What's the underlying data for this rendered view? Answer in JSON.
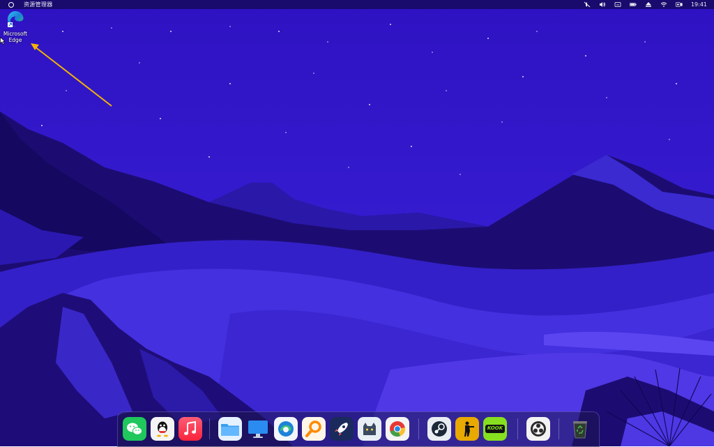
{
  "menubar": {
    "app_name": "资源管理器",
    "clock": "19:41",
    "tray_icons": [
      "mute-icon",
      "volume-icon",
      "cast-icon",
      "battery-icon",
      "eject-icon",
      "wifi-icon",
      "control-center-icon"
    ]
  },
  "desktop": {
    "icon": {
      "label_line1": "Microsoft",
      "label_line2": "Edge",
      "icon": "edge-icon"
    }
  },
  "dock": {
    "groups": [
      [
        "wechat",
        "qq",
        "music"
      ],
      [
        "files",
        "monitor",
        "edge",
        "search",
        "rocket",
        "cat-app",
        "chrome"
      ],
      [
        "steam",
        "counter-strike",
        "kook"
      ],
      [
        "obs"
      ],
      [
        "recycle-bin"
      ]
    ],
    "kook_label": "KOOK"
  },
  "colors": {
    "sky_top": "#3215c8",
    "sky_bottom": "#3a22d8",
    "mountain_dark": "#1a0a68",
    "dune": "#4a33e0",
    "accent_arrow": "#f5b301"
  }
}
